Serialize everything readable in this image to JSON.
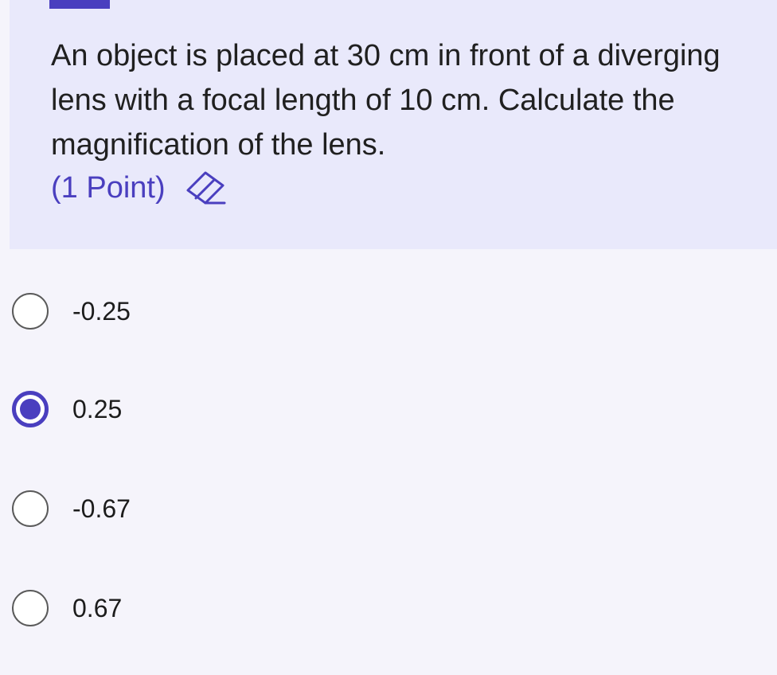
{
  "question": {
    "text": "An object is placed at 30 cm in front of a diverging lens with a focal length of 10 cm. Calculate the magnification of the lens.",
    "points": "(1 Point)",
    "eraser_icon": "eraser-icon"
  },
  "options": [
    {
      "label": "-0.25",
      "selected": false
    },
    {
      "label": "0.25",
      "selected": true
    },
    {
      "label": "-0.67",
      "selected": false
    },
    {
      "label": "0.67",
      "selected": false
    }
  ],
  "colors": {
    "accent": "#4a3fbf",
    "question_background": "#e9e9fb",
    "page_background": "#f5f4fb"
  }
}
